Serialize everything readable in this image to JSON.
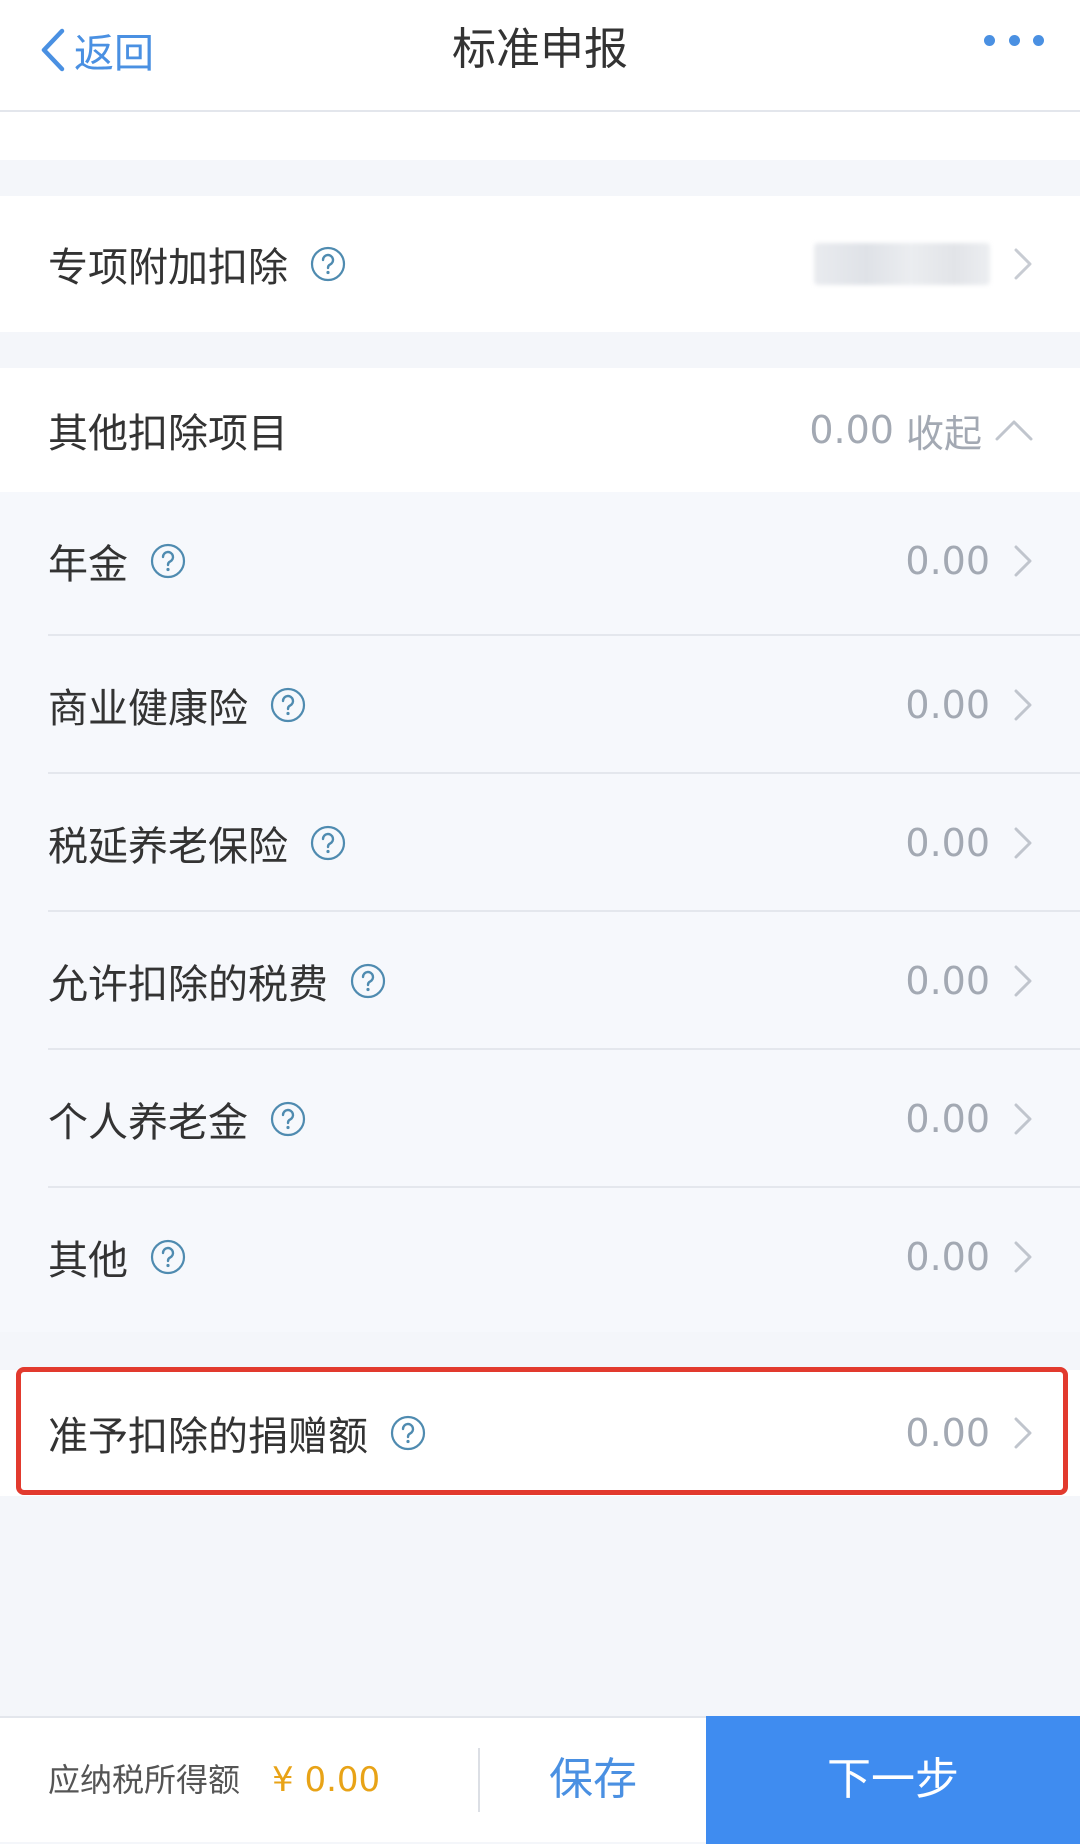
{
  "nav": {
    "back_label": "返回",
    "title": "标准申报"
  },
  "special_deduction": {
    "label": "专项附加扣除"
  },
  "other_deductions": {
    "label": "其他扣除项目",
    "total": "0.00",
    "toggle_label": "收起",
    "items": [
      {
        "label": "年金",
        "value": "0.00"
      },
      {
        "label": "商业健康险",
        "value": "0.00"
      },
      {
        "label": "税延养老保险",
        "value": "0.00"
      },
      {
        "label": "允许扣除的税费",
        "value": "0.00"
      },
      {
        "label": "个人养老金",
        "value": "0.00"
      },
      {
        "label": "其他",
        "value": "0.00"
      }
    ]
  },
  "donation": {
    "label": "准予扣除的捐赠额",
    "value": "0.00"
  },
  "bottom_bar": {
    "taxable_label": "应纳税所得额",
    "taxable_amount": "¥ 0.00",
    "save_label": "保存",
    "next_label": "下一步"
  },
  "colors": {
    "accent": "#4a90e2",
    "primary_button": "#3f8cf0",
    "amount": "#e8a317",
    "highlight": "#e23a2e"
  },
  "icons": {
    "back": "chevron-left-icon",
    "more": "more-dots-icon",
    "help": "question-circle-icon",
    "row_arrow": "chevron-right-icon",
    "collapse": "chevron-up-icon"
  }
}
